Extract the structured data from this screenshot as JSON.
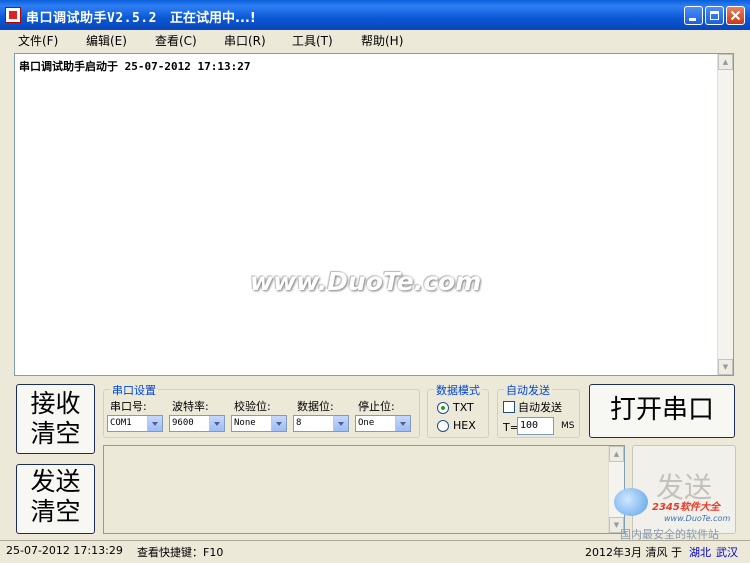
{
  "window": {
    "title": "串口调试助手V2.5.2",
    "status": "正在试用中...!"
  },
  "menu": [
    "文件(F)",
    "编辑(E)",
    "查看(C)",
    "串口(R)",
    "工具(T)",
    "帮助(H)"
  ],
  "receive": {
    "log_line": "串口调试助手启动于 25-07-2012 17:13:27"
  },
  "watermark": "www.DuoTe.com",
  "buttons": {
    "clear_receive": [
      "接收",
      "清空"
    ],
    "clear_send": [
      "发送",
      "清空"
    ],
    "open_port": "打开串口",
    "send": "发送"
  },
  "port_settings": {
    "group_title": "串口设置",
    "port_label": "串口号:",
    "port_value": "COM1",
    "baud_label": "波特率:",
    "baud_value": "9600",
    "parity_label": "校验位:",
    "parity_value": "None",
    "databits_label": "数据位:",
    "databits_value": "8",
    "stopbits_label": "停止位:",
    "stopbits_value": "One"
  },
  "data_mode": {
    "group_title": "数据模式",
    "txt_label": "TXT",
    "hex_label": "HEX",
    "selected": "TXT"
  },
  "auto_send": {
    "group_title": "自动发送",
    "checkbox_label": "自动发送",
    "checked": false,
    "interval_prefix": "T=",
    "interval_value": "100",
    "interval_unit": "MS"
  },
  "corner_logo": {
    "site_name": "2345软件大全",
    "site_url": "www.DuoTe.com",
    "tagline": "国内最安全的软件站"
  },
  "statusbar": {
    "datetime": "25-07-2012 17:13:29",
    "shortcut": "查看快捷键：F10",
    "author_date": "2012年3月 清风 于",
    "location_province": "湖北",
    "location_city": "武汉"
  },
  "colors": {
    "titlebar": "#0b58d4",
    "group_title": "#0046d5",
    "status_link": "#0000cc"
  }
}
